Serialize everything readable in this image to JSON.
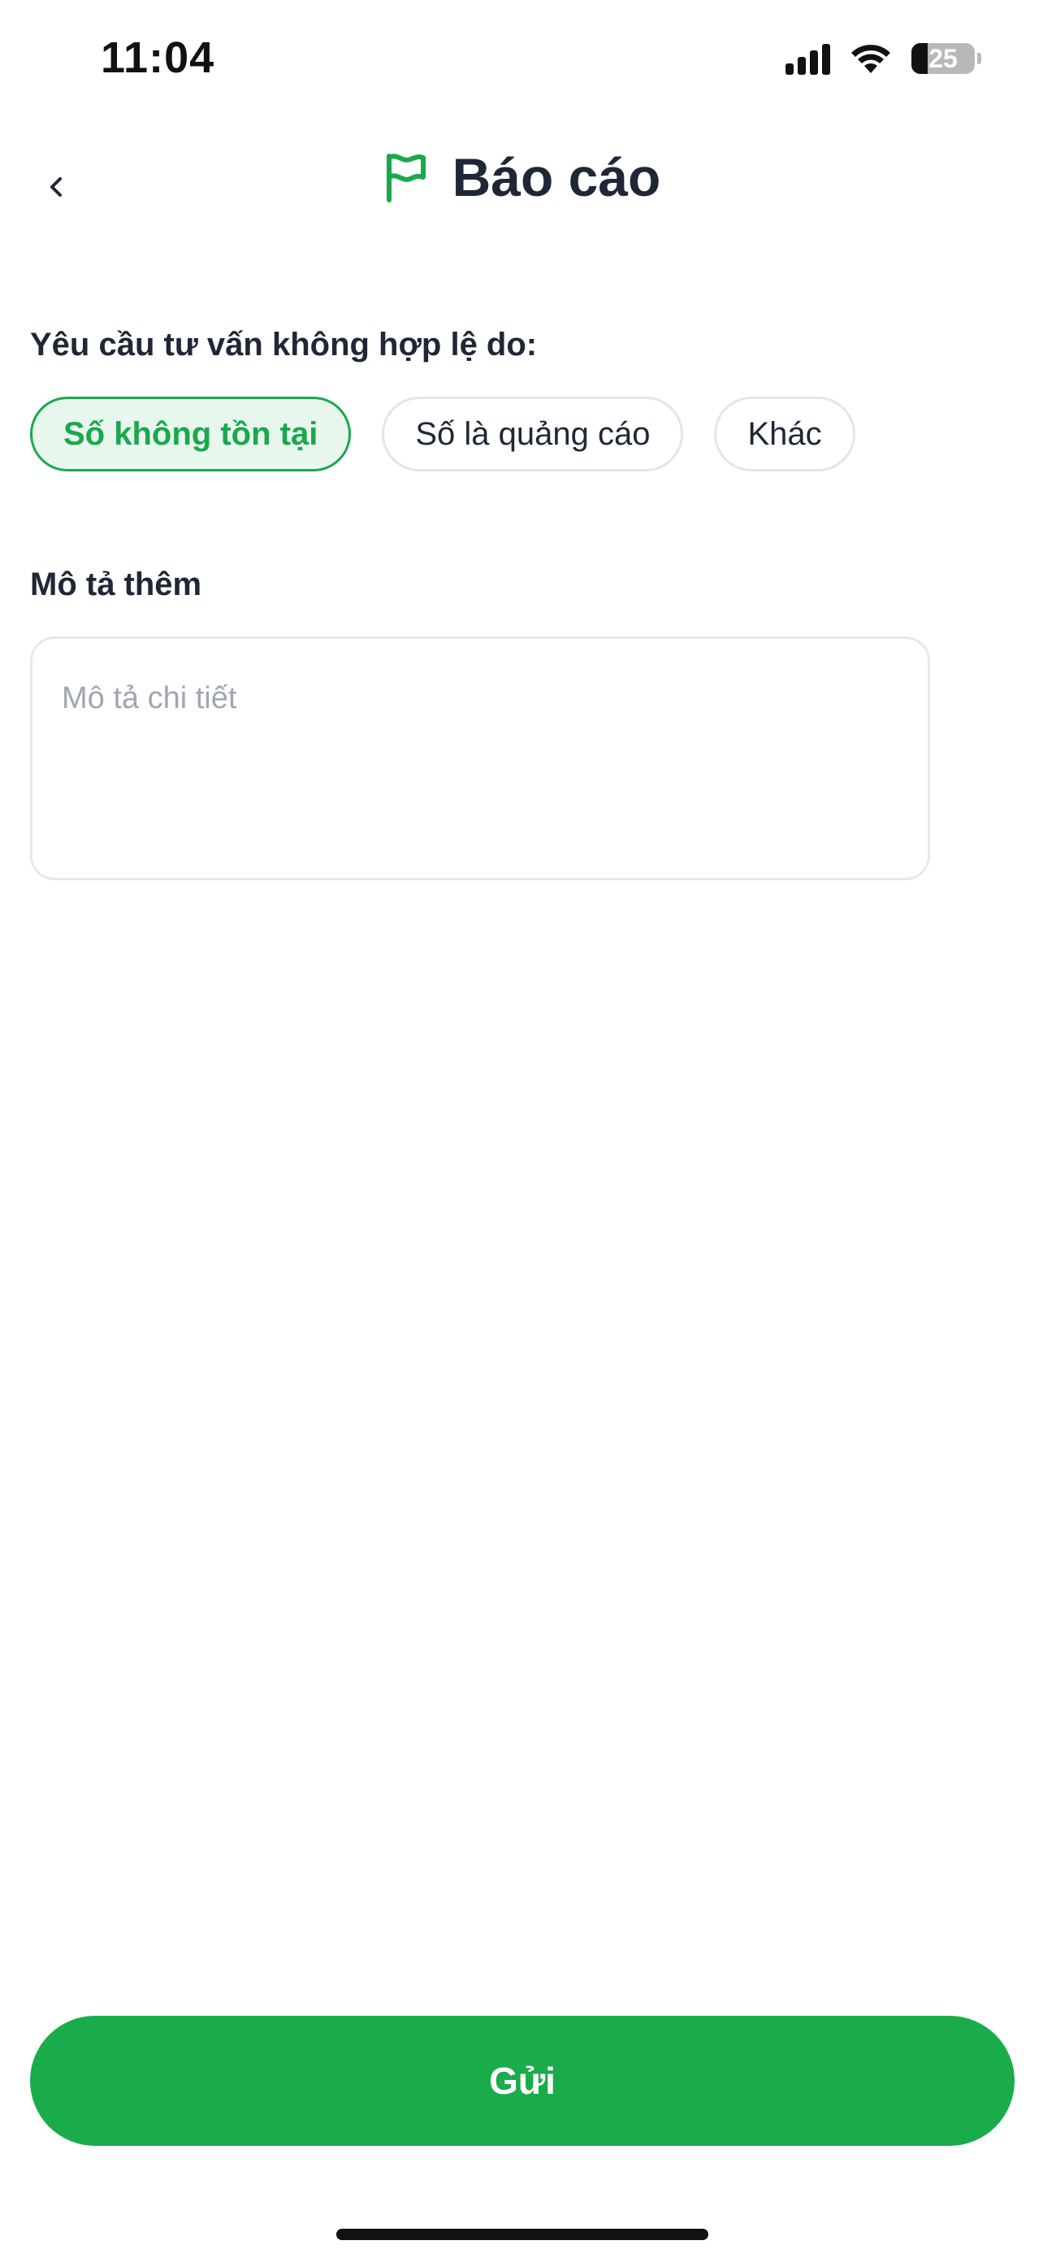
{
  "status_bar": {
    "time": "11:04",
    "battery_level": "25",
    "battery_fraction": 0.25
  },
  "header": {
    "title": "Báo cáo",
    "accent_color": "#1aa84d"
  },
  "reason": {
    "label": "Yêu cầu tư vấn không hợp lệ do:",
    "options": [
      {
        "label": "Số không tồn tại",
        "selected": true
      },
      {
        "label": "Số là quảng cáo",
        "selected": false
      },
      {
        "label": "Khác",
        "selected": false
      }
    ]
  },
  "description": {
    "label": "Mô tả thêm",
    "placeholder": "Mô tả chi tiết",
    "value": ""
  },
  "submit": {
    "label": "Gửi",
    "color": "#1aac4a"
  }
}
